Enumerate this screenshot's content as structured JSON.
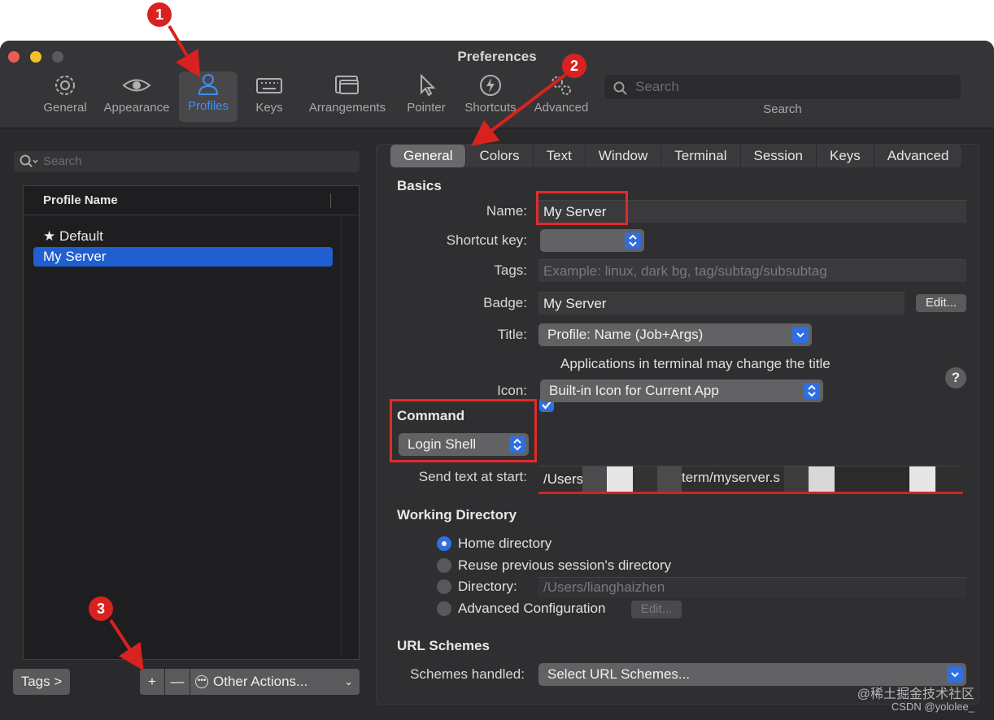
{
  "window": {
    "title": "Preferences"
  },
  "toolbar": {
    "items": [
      {
        "label": "General",
        "icon": "gear-icon"
      },
      {
        "label": "Appearance",
        "icon": "eye-icon"
      },
      {
        "label": "Profiles",
        "icon": "person-icon",
        "selected": true
      },
      {
        "label": "Keys",
        "icon": "keyboard-icon"
      },
      {
        "label": "Arrangements",
        "icon": "windows-icon"
      },
      {
        "label": "Pointer",
        "icon": "pointer-icon"
      },
      {
        "label": "Shortcuts",
        "icon": "bolt-icon"
      },
      {
        "label": "Advanced",
        "icon": "gears-icon"
      }
    ],
    "search_placeholder": "Search",
    "search_label": "Search"
  },
  "left": {
    "search_placeholder": "Search",
    "column_header": "Profile Name",
    "profiles": [
      {
        "label": "★ Default",
        "selected": false
      },
      {
        "label": "My Server",
        "selected": true
      }
    ],
    "tags_button": "Tags >",
    "plus_button": "+",
    "minus_button": "—",
    "other_actions": "Other Actions..."
  },
  "tabs": [
    "General",
    "Colors",
    "Text",
    "Window",
    "Terminal",
    "Session",
    "Keys",
    "Advanced"
  ],
  "basics": {
    "heading": "Basics",
    "name_label": "Name:",
    "name_value": "My Server",
    "shortcut_label": "Shortcut key:",
    "tags_label": "Tags:",
    "tags_placeholder": "Example: linux, dark bg, tag/subtag/subsubtag",
    "badge_label": "Badge:",
    "badge_value": "My Server",
    "badge_edit": "Edit...",
    "title_label": "Title:",
    "title_value": "Profile: Name (Job+Args)",
    "help": "?",
    "apps_change_title": "Applications in terminal may change the title",
    "apps_change_title_checked": true,
    "icon_label": "Icon:",
    "icon_value": "Built-in Icon for Current App"
  },
  "command": {
    "heading": "Command",
    "value": "Login Shell",
    "send_text_label": "Send text at start:",
    "send_text_visible_start": "/Users",
    "send_text_visible_mid": "term/myserver.s"
  },
  "working_directory": {
    "heading": "Working Directory",
    "options": [
      {
        "label": "Home directory",
        "selected": true
      },
      {
        "label": "Reuse previous session's directory",
        "selected": false
      },
      {
        "label": "Directory:",
        "selected": false
      },
      {
        "label": "Advanced Configuration",
        "selected": false
      }
    ],
    "directory_value": "/Users/lianghaizhen",
    "adv_edit": "Edit..."
  },
  "url_schemes": {
    "heading": "URL Schemes",
    "label": "Schemes handled:",
    "value": "Select URL Schemes..."
  },
  "annotations": [
    "1",
    "2",
    "3"
  ],
  "watermark": {
    "line1": "@稀土掘金技术社区",
    "line2": "CSDN @yololee_"
  },
  "colors": {
    "accent": "#2f6fe0",
    "annotation_red": "#d9221f"
  }
}
